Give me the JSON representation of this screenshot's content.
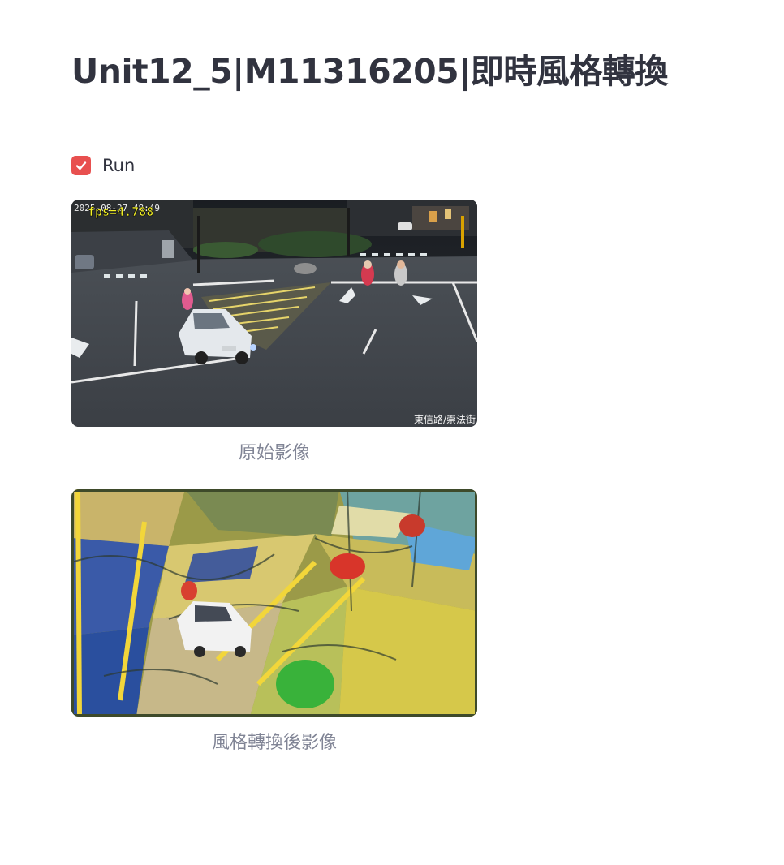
{
  "page": {
    "title": "Unit12_5|M11316205|即時風格轉換"
  },
  "controls": {
    "run_checkbox": {
      "label": "Run",
      "checked": true,
      "accent_color": "#e8504f"
    }
  },
  "original_frame": {
    "caption": "原始影像",
    "overlay": {
      "fps_text": "fps=4.788",
      "timestamp_text": "2025-08-27 48:49",
      "location_text": "東信路/崇法街"
    }
  },
  "styled_frame": {
    "caption": "風格轉換後影像"
  },
  "colors": {
    "title": "#31333f",
    "caption": "#808495",
    "fps_overlay": "#f4f22a"
  }
}
